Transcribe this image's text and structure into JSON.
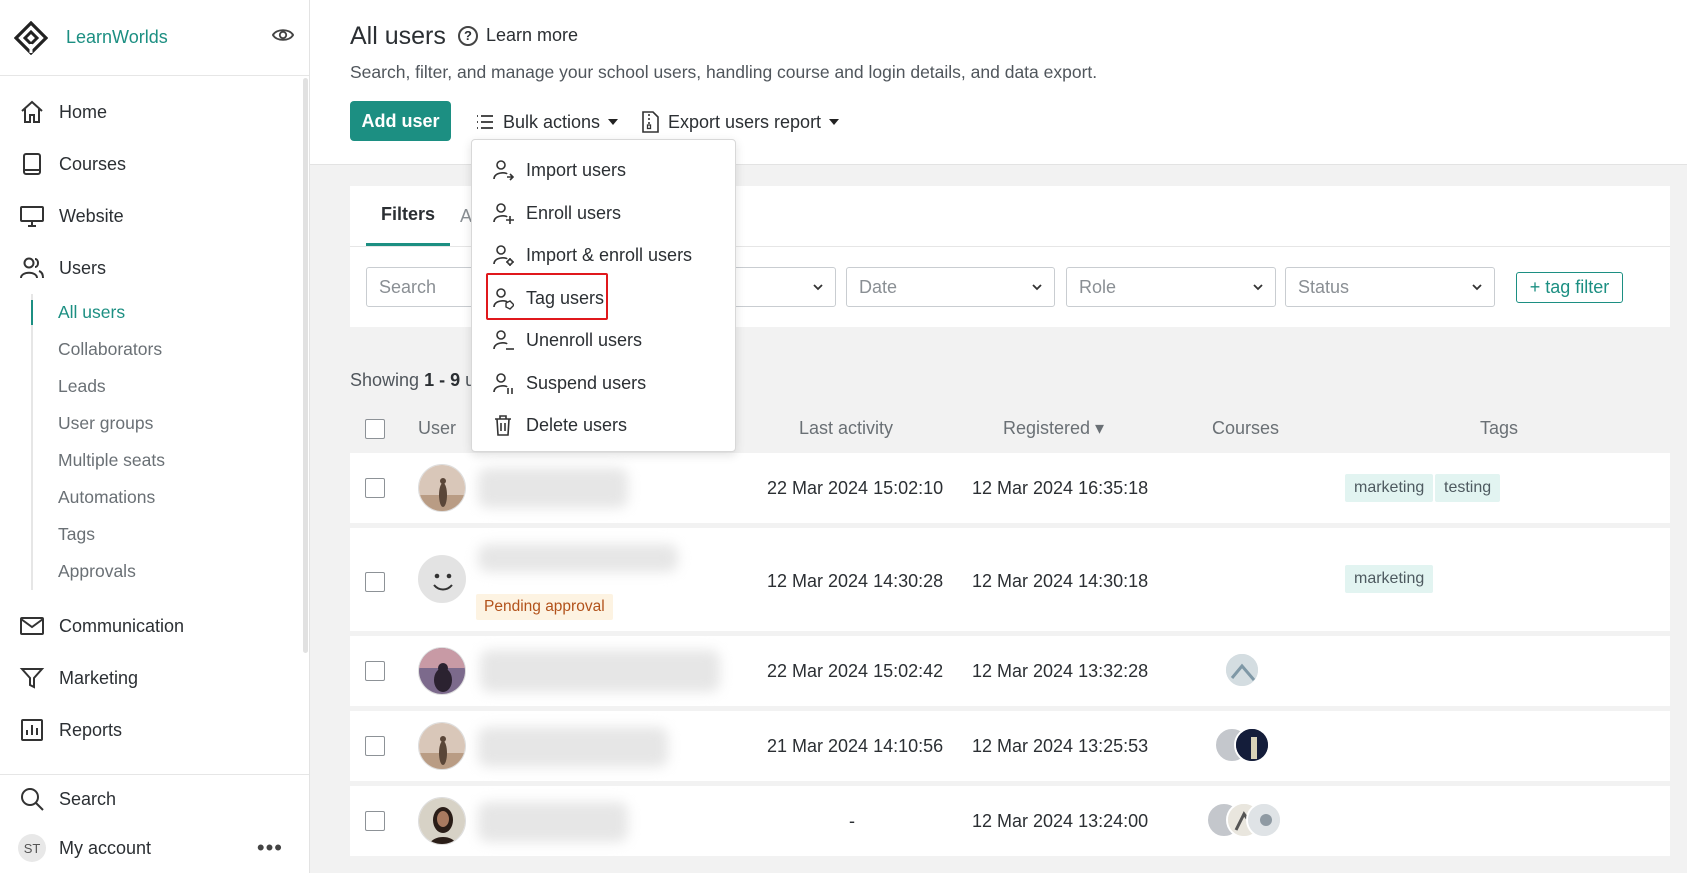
{
  "brand": {
    "name": "LearnWorlds"
  },
  "sidebar": {
    "items": [
      {
        "label": "Home",
        "icon": "home-icon"
      },
      {
        "label": "Courses",
        "icon": "book-icon"
      },
      {
        "label": "Website",
        "icon": "monitor-icon"
      },
      {
        "label": "Users",
        "icon": "users-icon"
      }
    ],
    "users_sub": [
      "All users",
      "Collaborators",
      "Leads",
      "User groups",
      "Multiple seats",
      "Automations",
      "Tags",
      "Approvals"
    ],
    "items_after": [
      {
        "label": "Communication",
        "icon": "mail-icon"
      },
      {
        "label": "Marketing",
        "icon": "filter-icon"
      },
      {
        "label": "Reports",
        "icon": "bar-chart-icon"
      }
    ],
    "search_label": "Search",
    "account_label": "My account",
    "account_initials": "ST"
  },
  "header": {
    "title": "All users",
    "learn_more": "Learn more",
    "subtitle": "Search, filter, and manage your school users, handling course and login details, and data export.",
    "add_user": "Add user",
    "bulk_actions": "Bulk actions",
    "export_report": "Export users report"
  },
  "bulk_menu": {
    "items": [
      "Import users",
      "Enroll users",
      "Import & enroll users",
      "Tag users",
      "Unenroll users",
      "Suspend users",
      "Delete users"
    ],
    "highlighted": "Tag users"
  },
  "filters": {
    "tab_active": "Filters",
    "tab_other": "A",
    "search_placeholder": "Search",
    "date": "Date",
    "role": "Role",
    "status": "Status",
    "tag_filter": "+ tag filter"
  },
  "showing": {
    "prefix": "Showing ",
    "range": "1 - 9",
    "suffix": " u"
  },
  "table": {
    "headers": {
      "user": "User",
      "last_activity": "Last activity",
      "registered": "Registered ▾",
      "courses": "Courses",
      "tags": "Tags"
    },
    "rows": [
      {
        "last_activity": "22 Mar 2024 15:02:10",
        "registered": "12 Mar 2024 16:35:18",
        "tags": [
          "marketing",
          "testing"
        ]
      },
      {
        "last_activity": "12 Mar 2024 14:30:28",
        "registered": "12 Mar 2024 14:30:18",
        "tags": [
          "marketing"
        ],
        "badge": "Pending approval"
      },
      {
        "last_activity": "22 Mar 2024 15:02:42",
        "registered": "12 Mar 2024 13:32:28",
        "tags": []
      },
      {
        "last_activity": "21 Mar 2024 14:10:56",
        "registered": "12 Mar 2024 13:25:53",
        "tags": []
      },
      {
        "last_activity": "-",
        "registered": "12 Mar 2024 13:24:00",
        "tags": []
      }
    ]
  },
  "colors": {
    "accent": "#1c8f82",
    "highlight_border": "#e0181c",
    "tag_bg": "#e2f4f1",
    "pending_bg": "#fdf3e2",
    "pending_text": "#b2521b"
  }
}
